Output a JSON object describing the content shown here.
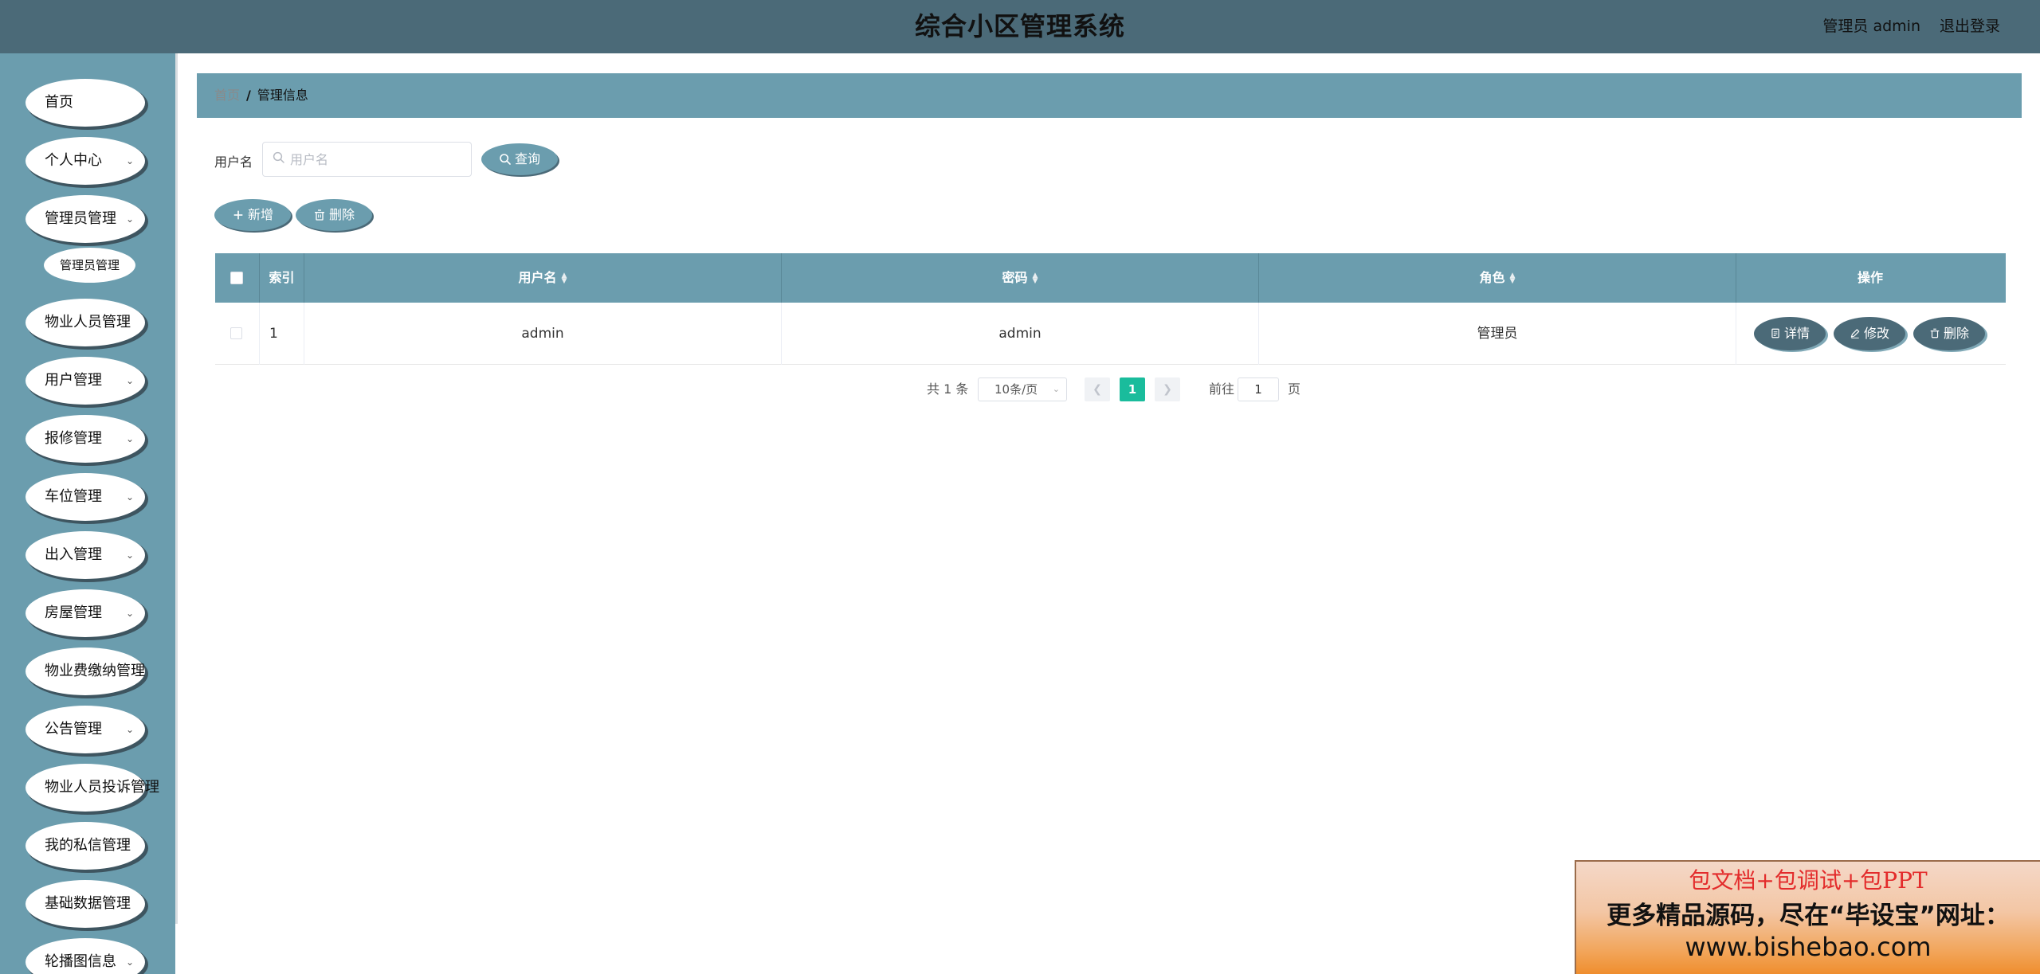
{
  "header": {
    "title": "综合小区管理系统",
    "user_label": "管理员 admin",
    "logout_label": "退出登录"
  },
  "sidebar": {
    "items": [
      {
        "label": "首页",
        "has_submenu": false
      },
      {
        "label": "个人中心",
        "has_submenu": true
      },
      {
        "label": "管理员管理",
        "has_submenu": true
      },
      {
        "label": "物业人员管理",
        "has_submenu": true
      },
      {
        "label": "用户管理",
        "has_submenu": true
      },
      {
        "label": "报修管理",
        "has_submenu": true
      },
      {
        "label": "车位管理",
        "has_submenu": true
      },
      {
        "label": "出入管理",
        "has_submenu": true
      },
      {
        "label": "房屋管理",
        "has_submenu": true
      },
      {
        "label": "物业费缴纳管理",
        "has_submenu": true
      },
      {
        "label": "公告管理",
        "has_submenu": true
      },
      {
        "label": "物业人员投诉管理",
        "has_submenu": true
      },
      {
        "label": "我的私信管理",
        "has_submenu": true
      },
      {
        "label": "基础数据管理",
        "has_submenu": true
      },
      {
        "label": "轮播图信息",
        "has_submenu": true
      }
    ],
    "submenu": {
      "label": "管理员管理"
    }
  },
  "breadcrumb": {
    "home": "首页",
    "separator": "/",
    "current": "管理信息"
  },
  "search": {
    "label": "用户名",
    "placeholder": "用户名",
    "value": "",
    "button_label": "查询"
  },
  "actions": {
    "add_label": "新增",
    "delete_label": "删除"
  },
  "table": {
    "columns": [
      "索引",
      "用户名",
      "密码",
      "角色",
      "操作"
    ],
    "rows": [
      {
        "index": "1",
        "username": "admin",
        "password": "admin",
        "role": "管理员"
      }
    ],
    "row_actions": {
      "detail": "详情",
      "edit": "修改",
      "delete": "删除"
    }
  },
  "pagination": {
    "total": "共 1 条",
    "page_size": "10条/页",
    "current_page": "1",
    "goto_label": "前往",
    "goto_value": "1",
    "page_suffix": "页"
  },
  "promo": {
    "line1": "包文档+包调试+包PPT",
    "line2": "更多精品源码，尽在“毕设宝”网址：",
    "line3": "www.bishebao.com"
  },
  "colors": {
    "header_bg": "#4b6a78",
    "sidebar_bg": "#6b9dae",
    "accent": "#6b9dae",
    "dark_button": "#4b6a78",
    "page_active": "#1abc9c"
  }
}
